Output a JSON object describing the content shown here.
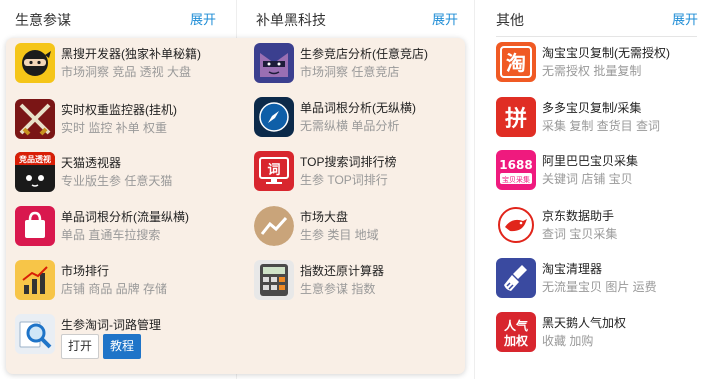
{
  "columns": [
    {
      "title": "生意参谋",
      "expand": "展开"
    },
    {
      "title": "补单黑科技",
      "expand": "展开"
    },
    {
      "title": "其他",
      "expand": "展开"
    }
  ],
  "left_tools": [
    {
      "name": "黑搜开发器(独家补单秘籍)",
      "desc": "市场洞察 竞品 透视 大盘",
      "icon": "ninja-icon"
    },
    {
      "name": "实时权重监控器(挂机)",
      "desc": "实时 监控 补单 权重",
      "icon": "crossed-swords-icon"
    },
    {
      "name": "天猫透视器",
      "desc": "专业版生参 任意天猫",
      "icon": "tmall-icon",
      "badge": "竞品透视"
    },
    {
      "name": "单品词根分析(流量纵横)",
      "desc": "单品 直通车拉搜索",
      "icon": "shopping-bag-icon"
    },
    {
      "name": "市场排行",
      "desc": "店铺 商品 品牌 存储",
      "icon": "bar-chart-icon"
    },
    {
      "name": "生参淘词-词路管理",
      "desc": "",
      "icon": "magnifier-icon"
    }
  ],
  "mid_tools": [
    {
      "name": "生参竞店分析(任意竞店)",
      "desc": "市场洞察 任意竞店",
      "icon": "mask-face-icon"
    },
    {
      "name": "单品词根分析(无纵横)",
      "desc": "无需纵横 单品分析",
      "icon": "compass-icon"
    },
    {
      "name": "TOP搜索词排行榜",
      "desc": "生参 TOP词排行",
      "icon": "monitor-icon",
      "badge": "词"
    },
    {
      "name": "市场大盘",
      "desc": "生参 类目 地域",
      "icon": "trend-icon"
    },
    {
      "name": "指数还原计算器",
      "desc": "生意参谋 指数",
      "icon": "calculator-icon"
    }
  ],
  "right_tools": [
    {
      "name": "淘宝宝贝复制(无需授权)",
      "desc": "无需授权 批量复制",
      "icon": "taobao-icon",
      "badge": "淘"
    },
    {
      "name": "多多宝贝复制/采集",
      "desc": "采集 复制 查货目 查词",
      "icon": "pinduoduo-icon",
      "badge": "拼"
    },
    {
      "name": "阿里巴巴宝贝采集",
      "desc": "关键词 店铺 宝贝",
      "icon": "alibaba-1688-icon",
      "badge": "1688",
      "badge2": "宝贝采集"
    },
    {
      "name": "京东数据助手",
      "desc": "查词 宝贝采集",
      "icon": "jd-dog-icon"
    },
    {
      "name": "淘宝清理器",
      "desc": "无流量宝贝 图片 运费",
      "icon": "broom-icon"
    },
    {
      "name": "黑天鹅人气加权",
      "desc": "收藏 加购",
      "icon": "popularity-icon",
      "badge": "人气",
      "badge2": "加权"
    }
  ],
  "buttons": {
    "open": "打开",
    "guide": "教程"
  },
  "colors": {
    "accent": "#1f8dd6",
    "panel_bg": "#f9efe6",
    "guide_bg": "#1f74c8"
  }
}
